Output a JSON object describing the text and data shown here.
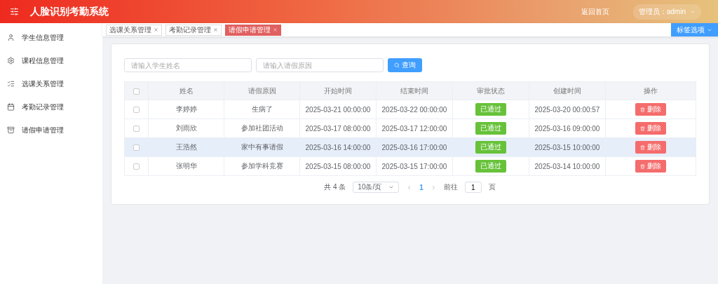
{
  "header": {
    "title": "人脸识别考勤系统",
    "home_link": "返回首页",
    "user_menu": "管理员：admin"
  },
  "sidebar": {
    "items": [
      {
        "label": "学生信息管理",
        "selected": false
      },
      {
        "label": "课程信息管理",
        "selected": false
      },
      {
        "label": "选课关系管理",
        "selected": false
      },
      {
        "label": "考勤记录管理",
        "selected": false
      },
      {
        "label": "请假申请管理",
        "selected": false
      }
    ]
  },
  "tabs": [
    {
      "label": "选课关系管理",
      "selected": false
    },
    {
      "label": "考勤记录管理",
      "selected": false
    },
    {
      "label": "请假申请管理",
      "selected": true
    }
  ],
  "tab_options": "标签选项",
  "search": {
    "name_placeholder": "请输入学生姓名",
    "reason_placeholder": "请输入请假原因",
    "button": "查询"
  },
  "table": {
    "all_checked": false,
    "columns": [
      "姓名",
      "请假原因",
      "开始时间",
      "结束时间",
      "审批状态",
      "创建时间",
      "操作"
    ],
    "rows": [
      {
        "checked": false,
        "highlighted": false,
        "name": "李婷婷",
        "reason": "生病了",
        "start": "2025-03-21 00:00:00",
        "end": "2025-03-22 00:00:00",
        "status": "已通过",
        "created": "2025-03-20 00:00:57",
        "action": "删除"
      },
      {
        "checked": false,
        "highlighted": false,
        "name": "刘雨欣",
        "reason": "参加社团活动",
        "start": "2025-03-17 08:00:00",
        "end": "2025-03-17 12:00:00",
        "status": "已通过",
        "created": "2025-03-16 09:00:00",
        "action": "删除"
      },
      {
        "checked": false,
        "highlighted": true,
        "name": "王浩然",
        "reason": "家中有事请假",
        "start": "2025-03-16 14:00:00",
        "end": "2025-03-16 17:00:00",
        "status": "已通过",
        "created": "2025-03-15 10:00:00",
        "action": "删除"
      },
      {
        "checked": false,
        "highlighted": false,
        "name": "张明华",
        "reason": "参加学科竞赛",
        "start": "2025-03-15 08:00:00",
        "end": "2025-03-15 17:00:00",
        "status": "已通过",
        "created": "2025-03-14 10:00:00",
        "action": "删除"
      }
    ]
  },
  "pagination": {
    "total": "共 4 条",
    "page_size": "10条/页",
    "pages": [
      {
        "label": "1",
        "selected": true
      }
    ],
    "goto_label": "前往",
    "goto_value": "1",
    "goto_suffix": "页"
  }
}
